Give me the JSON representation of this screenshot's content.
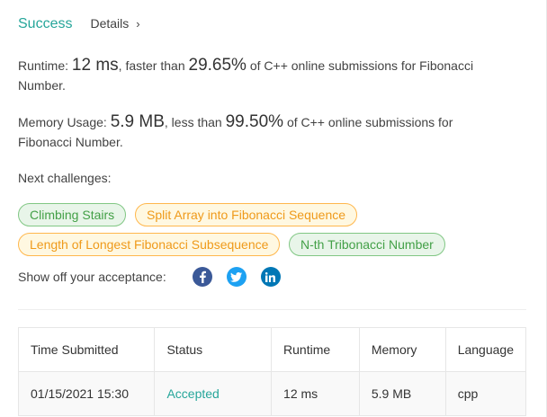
{
  "header": {
    "status": "Success",
    "details_label": "Details"
  },
  "runtime": {
    "label": "Runtime: ",
    "value": "12 ms",
    "comparison": ", faster than ",
    "percent": "29.65%",
    "suffix": " of C++ online submissions for Fibonacci Number."
  },
  "memory": {
    "label": "Memory Usage: ",
    "value": "5.9 MB",
    "comparison": ", less than ",
    "percent": "99.50%",
    "suffix": " of C++ online submissions for Fibonacci Number."
  },
  "next_challenges": {
    "label": "Next challenges:",
    "items": [
      {
        "label": "Climbing Stairs",
        "difficulty": "easy"
      },
      {
        "label": "Split Array into Fibonacci Sequence",
        "difficulty": "medium"
      },
      {
        "label": "Length of Longest Fibonacci Subsequence",
        "difficulty": "medium"
      },
      {
        "label": "N-th Tribonacci Number",
        "difficulty": "easy"
      }
    ]
  },
  "share": {
    "label": "Show off your acceptance:",
    "icons": [
      "facebook-icon",
      "twitter-icon",
      "linkedin-icon"
    ]
  },
  "table": {
    "headers": [
      "Time Submitted",
      "Status",
      "Runtime",
      "Memory",
      "Language"
    ],
    "rows": [
      [
        "01/15/2021 15:30",
        "Accepted",
        "12 ms",
        "5.9 MB",
        "cpp"
      ]
    ]
  },
  "colors": {
    "accent": "#26a69a",
    "easy": "#43a047",
    "medium": "#ef9a1a"
  }
}
